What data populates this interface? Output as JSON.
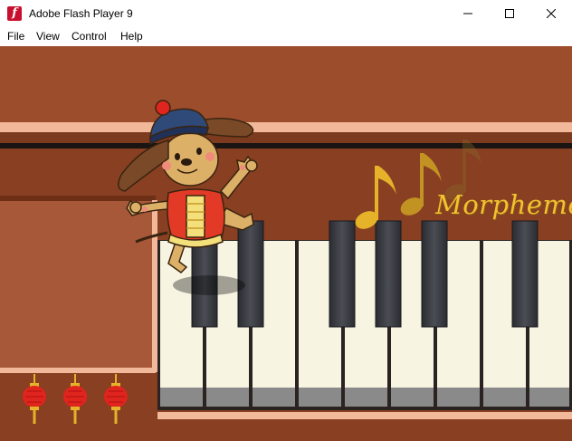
{
  "window": {
    "title": "Adobe Flash Player 9"
  },
  "menu": {
    "file": "File",
    "view": "View",
    "control": "Control",
    "help": "Help"
  },
  "stage": {
    "brand_text": "Morpheme",
    "lantern_count": 3
  },
  "colors": {
    "wall": "#9c4e2c",
    "trim": "#f2b89a",
    "gold": "#e5b22a",
    "lantern": "#e0241e"
  },
  "icons": {
    "app": "flash-player-icon",
    "minimize": "minimize-icon",
    "maximize": "maximize-icon",
    "close": "close-icon"
  }
}
